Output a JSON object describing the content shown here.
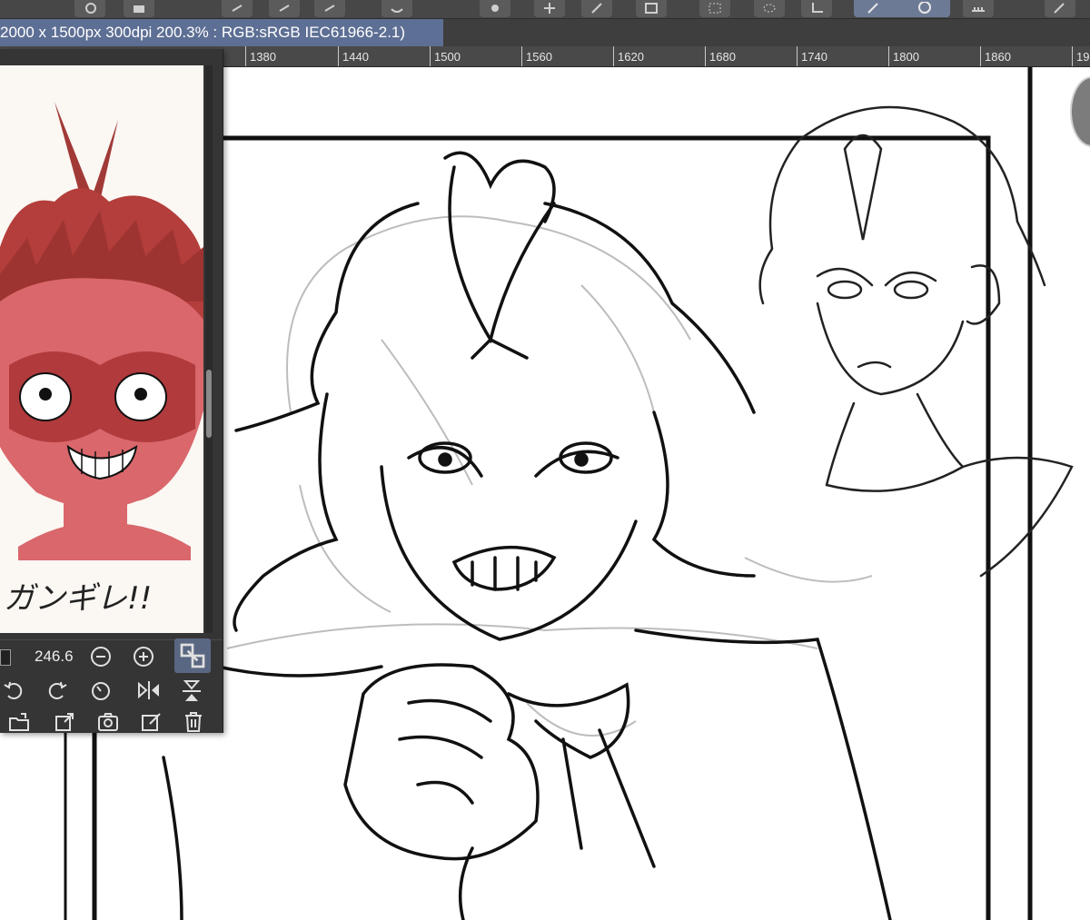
{
  "document": {
    "title": "2000 x 1500px 300dpi 200.3% : RGB:sRGB IEC61966-2.1)"
  },
  "ruler": {
    "labels": [
      "1380",
      "1440",
      "1500",
      "1560",
      "1620",
      "1680",
      "1740",
      "1800",
      "1860",
      "19"
    ]
  },
  "navigator": {
    "preview_caption": "ガンギレ!!",
    "zoom_value": "246.6",
    "controls_row1": [
      "zoom-out-icon",
      "zoom-in-icon",
      "fit-icon"
    ],
    "controls_row2": [
      "rotate-left-icon",
      "rotate-right-icon",
      "reset-rotation-icon",
      "flip-horizontal-icon",
      "flip-vertical-icon"
    ],
    "controls_row3": [
      "import-image-icon",
      "open-external-icon",
      "camera-icon",
      "edit-icon",
      "trash-icon"
    ]
  },
  "colors": {
    "toolbar": "#474747",
    "doc_tab": "#5d6f94",
    "panel": "#353535",
    "active_control": "#596782",
    "preview_skin": "#d9676b",
    "preview_hair": "#b33e3b"
  }
}
